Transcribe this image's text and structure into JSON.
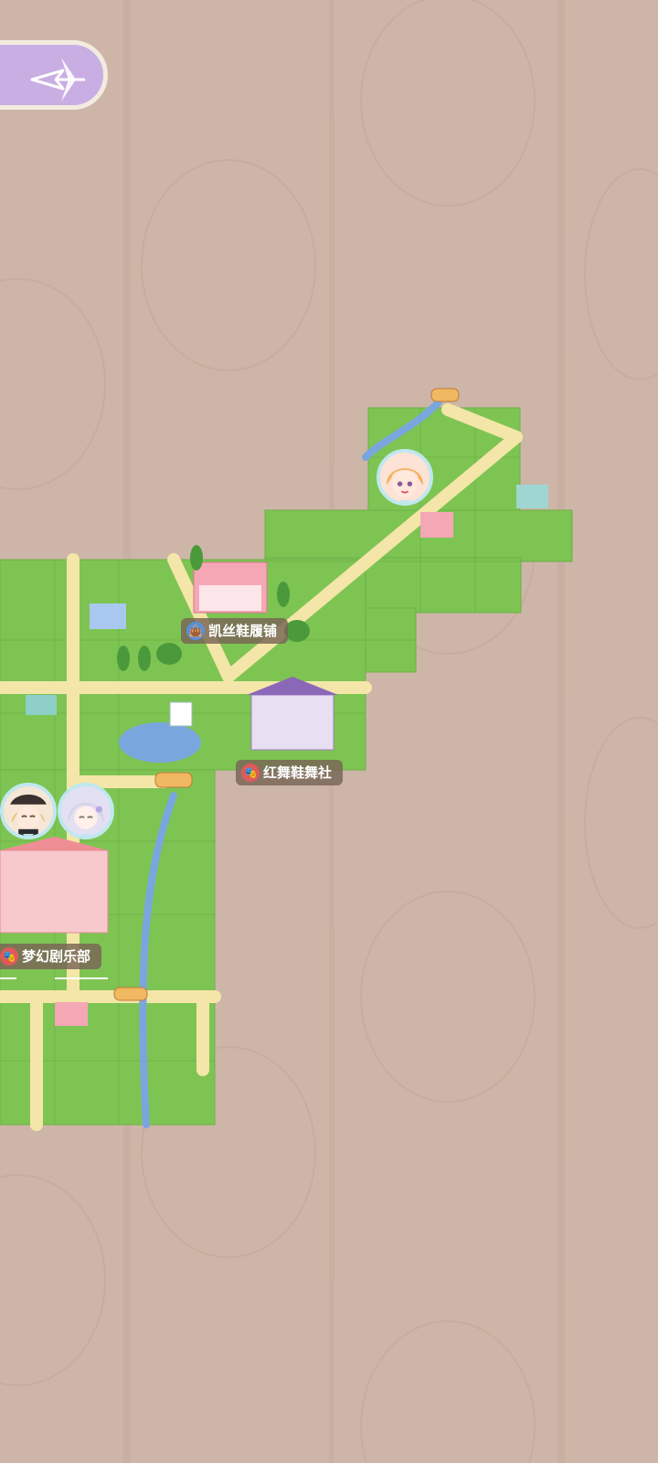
{
  "topbar": {
    "back_button": {
      "icon": "compass-arrow-icon"
    }
  },
  "colors": {
    "background": "#cdb6a8",
    "grass": "#7ec453",
    "path": "#f3e6a8",
    "water": "#7aa6de",
    "button": "#c9aee4"
  },
  "locations": [
    {
      "id": "shoe_shop",
      "name": "凯丝鞋履铺",
      "icon": "shopping-bag-icon",
      "badge_color": "#5b8fd6"
    },
    {
      "id": "dance_club",
      "name": "红舞鞋舞社",
      "icon": "drama-masks-icon",
      "badge_color": "#e05a5a"
    },
    {
      "id": "theater",
      "name": "梦幻剧乐部",
      "icon": "theater-icon",
      "badge_color": "#e05a5a"
    }
  ],
  "characters": [
    {
      "id": "blonde_girl",
      "icon": "character-avatar-icon"
    },
    {
      "id": "dark_hat_girl",
      "icon": "character-avatar-icon"
    },
    {
      "id": "silver_hair_girl",
      "icon": "character-avatar-icon"
    }
  ]
}
